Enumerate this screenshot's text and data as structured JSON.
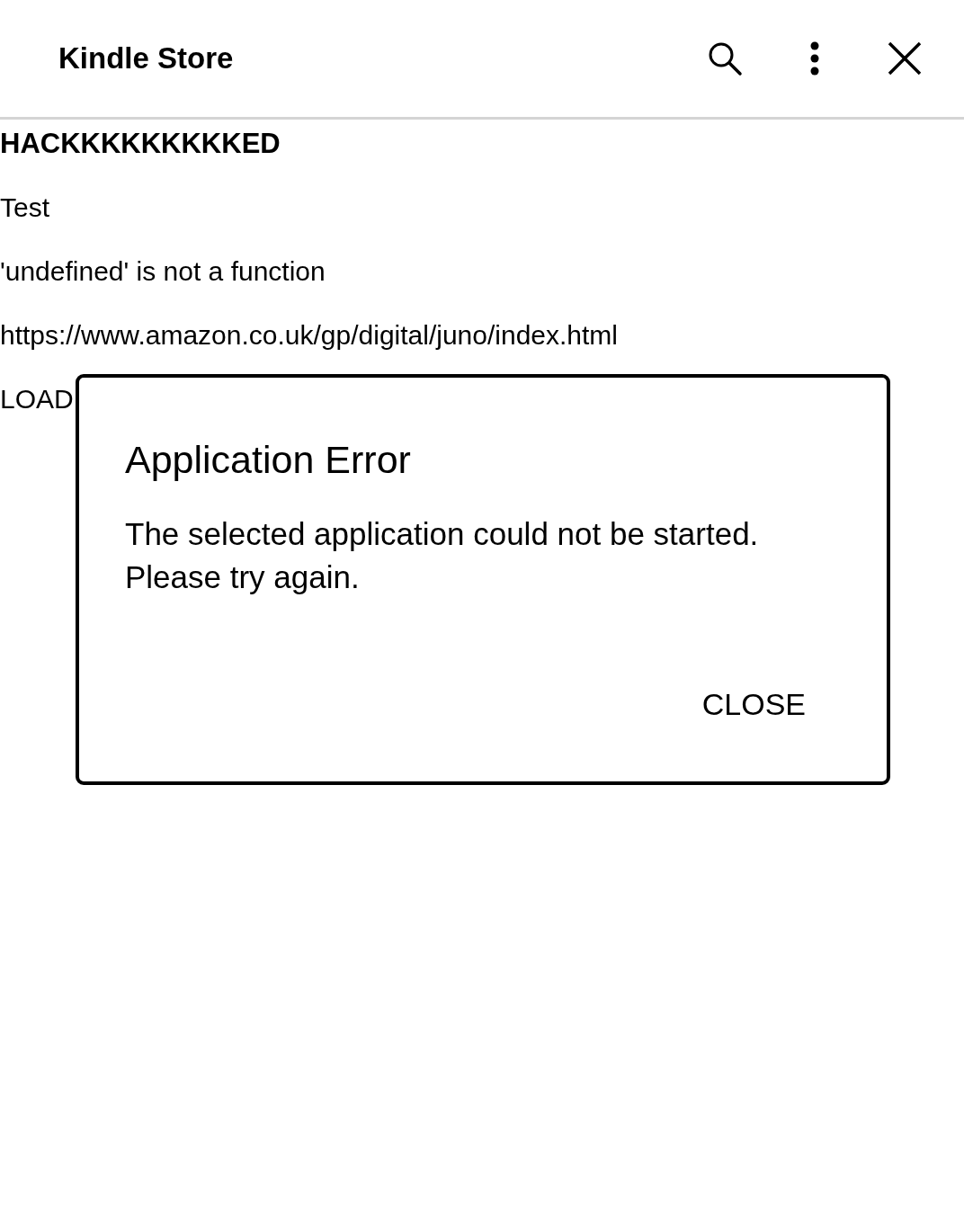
{
  "header": {
    "title": "Kindle Store"
  },
  "content": {
    "lines": [
      {
        "text": "HACKKKKKKKKKED",
        "kind": "heading"
      },
      {
        "text": "Test",
        "kind": "text"
      },
      {
        "text": "'undefined' is not a function",
        "kind": "text"
      },
      {
        "text": "https://www.amazon.co.uk/gp/digital/juno/index.html",
        "kind": "text"
      },
      {
        "text": "LOAD",
        "kind": "text"
      }
    ]
  },
  "dialog": {
    "title": "Application Error",
    "message": "The selected application could not be started. Please try again.",
    "button": "CLOSE"
  }
}
